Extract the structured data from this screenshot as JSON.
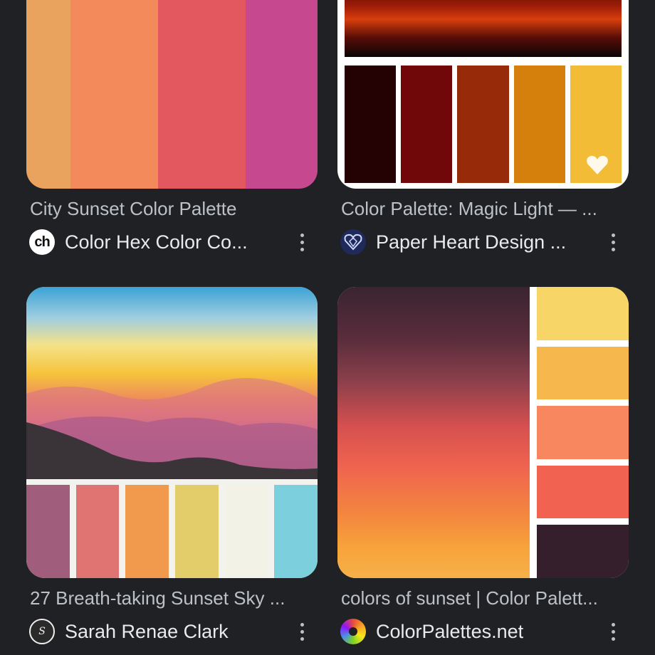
{
  "results": [
    {
      "title": "City Sunset Color Palette",
      "source": "Color Hex Color Co...",
      "icon": "ch-logo-icon",
      "icon_text": "ch",
      "swatches": [
        "#e9a35e",
        "#f38a5c",
        "#e3585f",
        "#c6488e"
      ]
    },
    {
      "title": "Color Palette: Magic Light — ...",
      "source": "Paper Heart Design ...",
      "icon": "paper-heart-icon",
      "swatches": [
        "#240204",
        "#700709",
        "#972b09",
        "#d5800c",
        "#f3bc36"
      ]
    },
    {
      "title": "27 Breath-taking Sunset Sky ...",
      "source": "Sarah Renae Clark",
      "icon": "sarah-renae-clark-icon",
      "swatches": [
        "#a15e7c",
        "#e07472",
        "#f19a4d",
        "#e3cc6a",
        "#f3f2e6",
        "#7ccfdc"
      ]
    },
    {
      "title": "colors of sunset | Color Palett...",
      "source": "ColorPalettes.net",
      "icon": "colorpalettes-icon",
      "swatches": [
        "#f7d567",
        "#f6b84c",
        "#f8875f",
        "#f26250",
        "#361f2d"
      ]
    }
  ]
}
